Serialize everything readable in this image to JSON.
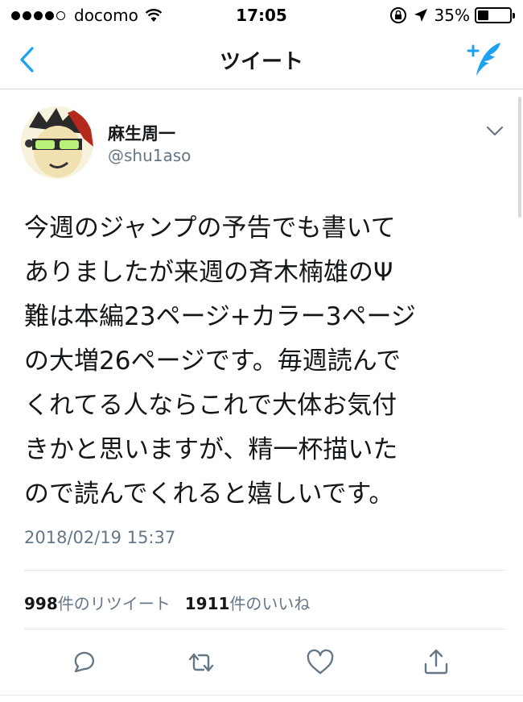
{
  "status_bar": {
    "carrier": "docomo",
    "time": "17:05",
    "battery": "35%",
    "battery_level": 0.35,
    "signal_bars": 4,
    "signal_total": 5
  },
  "nav": {
    "title": "ツイート",
    "back_icon": "chevron-left-icon",
    "compose_icon": "compose-tweet-icon"
  },
  "tweet": {
    "author_name": "麻生周一",
    "author_handle": "@shu1aso",
    "text": "今週のジャンプの予告でも書いて\nありましたが来週の斉木楠雄のΨ\n難は本編23ページ+カラー3ページ\nの大増26ページです。毎週読んで\nくれてる人ならこれで大体お気付\nきかと思いますが、精一杯描いた\nので読んでくれると嬉しいです。",
    "date": "2018/02/19 15:37"
  },
  "stats": {
    "retweet_count": "998",
    "retweet_label": "件のリツイート",
    "like_count": "1911",
    "like_label": "件のいいね"
  },
  "actions": [
    "reply-icon",
    "retweet-icon",
    "like-icon",
    "share-icon"
  ],
  "colors": {
    "accent": "#1da1f2",
    "secondary_text": "#657786",
    "primary_text": "#14171a",
    "action_icon": "#657786"
  }
}
